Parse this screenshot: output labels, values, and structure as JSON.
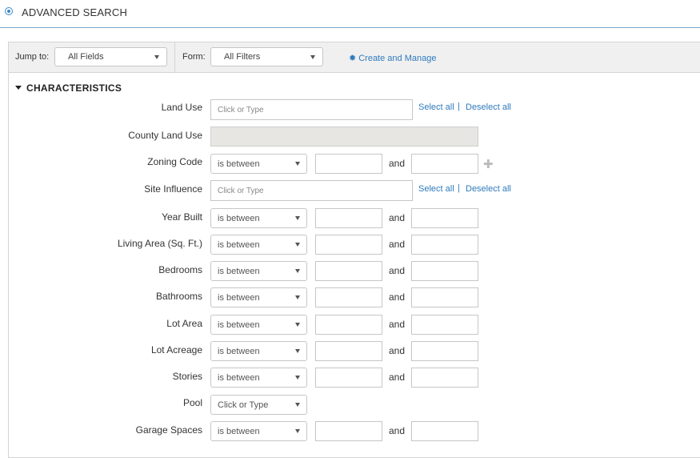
{
  "header": {
    "title": "ADVANCED SEARCH"
  },
  "filterbar": {
    "jump_label": "Jump to:",
    "jump_value": "All Fields",
    "form_label": "Form:",
    "form_value": "All Filters",
    "create_manage": "Create and Manage"
  },
  "section": {
    "title": "CHARACTERISTICS"
  },
  "common": {
    "placeholder": "Click or Type",
    "select_all": "Select all",
    "deselect_all": "Deselect all",
    "separator": "|",
    "and": "and",
    "between": "is between"
  },
  "fields": {
    "land_use": "Land Use",
    "county_land_use": "County Land Use",
    "zoning_code": "Zoning Code",
    "site_influence": "Site Influence",
    "year_built": "Year Built",
    "living_area": "Living Area (Sq. Ft.)",
    "bedrooms": "Bedrooms",
    "bathrooms": "Bathrooms",
    "lot_area": "Lot Area",
    "lot_acreage": "Lot Acreage",
    "stories": "Stories",
    "pool": "Pool",
    "pool_value": "Click or Type",
    "garage_spaces": "Garage Spaces"
  }
}
